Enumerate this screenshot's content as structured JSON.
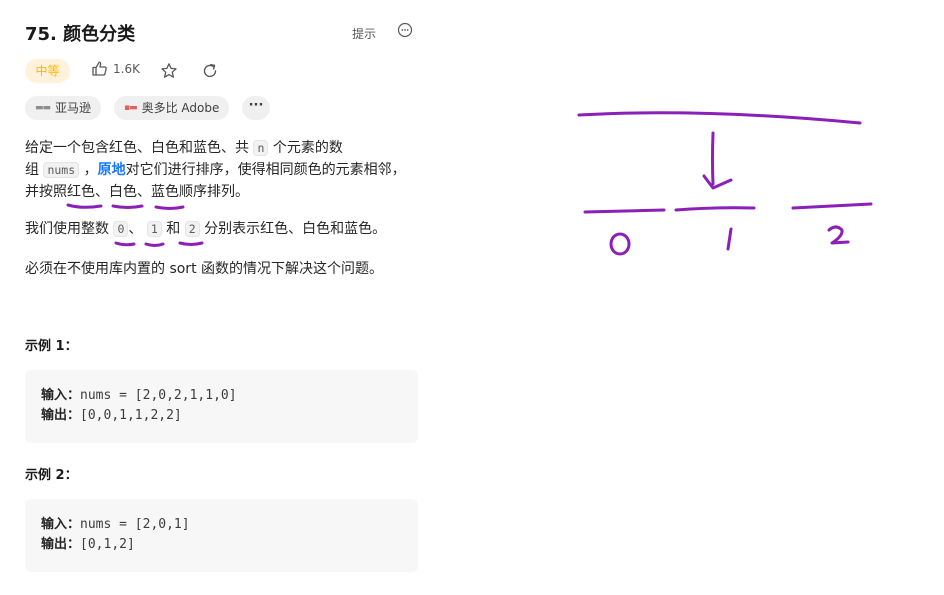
{
  "problem": {
    "title": "75. 颜色分类",
    "hint_label": "提示",
    "more_icon": "more-circle-icon",
    "difficulty": "中等",
    "likes": "1.6K",
    "like_icon": "thumbs-up-icon",
    "star_icon": "star-icon",
    "redo_icon": "refresh-icon",
    "tags": [
      "亚马逊",
      "奥多比 Adobe"
    ],
    "tag_more": "···"
  },
  "description": {
    "p1_a": "给定一个包含红色、白色和蓝色、共 ",
    "p1_code_n": "n",
    "p1_b": " 个元素的数",
    "p1_c": "组 ",
    "p1_code_nums": "nums",
    "p1_d": " ，",
    "p1_bold": "原地",
    "p1_e": "对它们进行排序，使得相同颜色的元素相邻，",
    "p1_f": "并按照红色、白色、蓝色顺序排列。",
    "p2_a": "我们使用整数 ",
    "p2_code0": "0",
    "p2_b": "、 ",
    "p2_code1": "1",
    "p2_c": " 和 ",
    "p2_code2": "2",
    "p2_d": " 分别表示红色、白色和蓝色。",
    "p3": "必须在不使用库内置的 sort 函数的情况下解决这个问题。"
  },
  "examples": [
    {
      "title": "示例 1：",
      "input_label": "输入：",
      "input": "nums = [2,0,2,1,1,0]",
      "output_label": "输出：",
      "output": "[0,0,1,1,2,2]"
    },
    {
      "title": "示例 2：",
      "input_label": "输入：",
      "input": "nums = [2,0,1]",
      "output_label": "输出：",
      "output": "[0,1,2]"
    }
  ],
  "sketch": {
    "color": "#8b1fb8",
    "labels": [
      "0",
      "1",
      "2"
    ]
  }
}
